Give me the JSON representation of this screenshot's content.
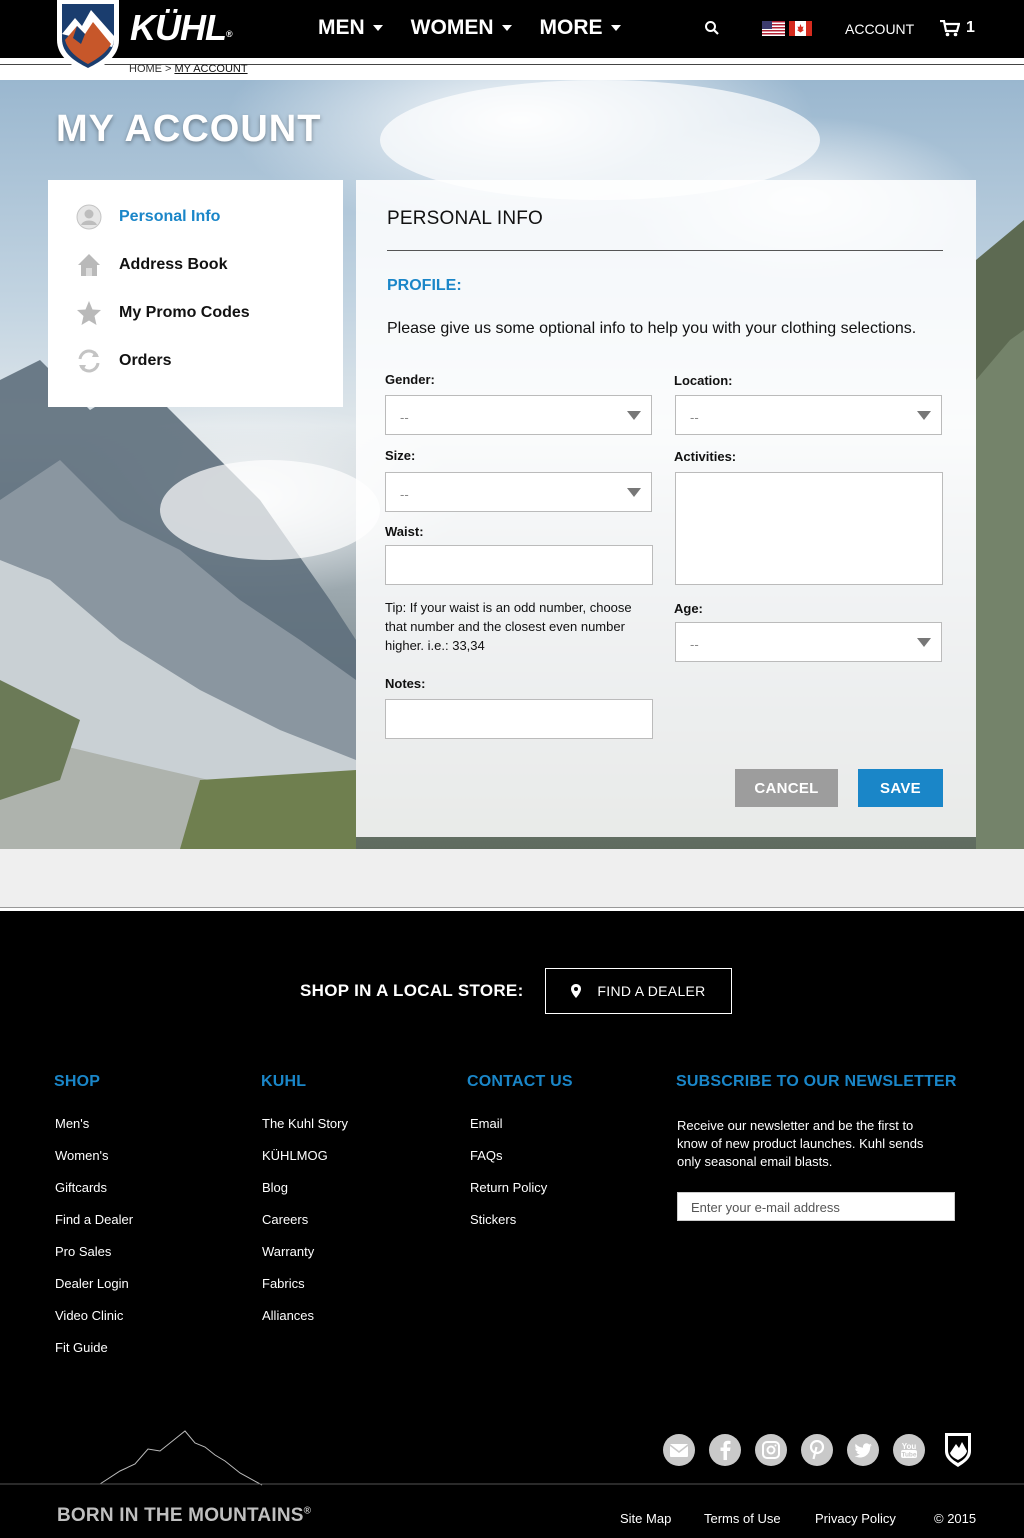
{
  "header": {
    "brand": "KÜHL",
    "brand_mark": "®",
    "nav": [
      {
        "label": "MEN"
      },
      {
        "label": "WOMEN"
      },
      {
        "label": "MORE"
      }
    ],
    "account_label": "ACCOUNT",
    "cart_count": "1"
  },
  "breadcrumb": {
    "home": "HOME",
    "separator": ">",
    "current": "MY ACCOUNT"
  },
  "page": {
    "title": "MY ACCOUNT"
  },
  "sidebar": {
    "items": [
      {
        "label": "Personal Info",
        "icon": "user-icon",
        "active": true
      },
      {
        "label": "Address Book",
        "icon": "home-icon"
      },
      {
        "label": "My Promo Codes",
        "icon": "star-icon"
      },
      {
        "label": "Orders",
        "icon": "refresh-icon"
      }
    ]
  },
  "form": {
    "title": "PERSONAL INFO",
    "section": "PROFILE:",
    "intro": "Please give us some optional info to help you with your clothing selections.",
    "gender": {
      "label": "Gender:",
      "value": "--"
    },
    "location": {
      "label": "Location:",
      "value": "--"
    },
    "size": {
      "label": "Size:",
      "value": "--"
    },
    "activities": {
      "label": "Activities:"
    },
    "waist": {
      "label": "Waist:",
      "value": ""
    },
    "tip": "Tip: If your waist is an odd number, choose that number and the closest even number higher. i.e.: 33,34",
    "age": {
      "label": "Age:",
      "value": "--"
    },
    "notes": {
      "label": "Notes:",
      "value": ""
    },
    "cancel_label": "CANCEL",
    "save_label": "SAVE"
  },
  "footer": {
    "local_store_label": "SHOP IN A LOCAL STORE:",
    "find_dealer_label": "FIND A DEALER",
    "columns": [
      {
        "title": "SHOP",
        "links": [
          "Men's",
          "Women's",
          "Giftcards",
          "Find a Dealer",
          "Pro Sales",
          "Dealer Login",
          "Video Clinic",
          "Fit Guide"
        ]
      },
      {
        "title": "KUHL",
        "links": [
          "The Kuhl Story",
          "KÜHLMOG",
          "Blog",
          "Careers",
          "Warranty",
          "Fabrics",
          "Alliances"
        ]
      },
      {
        "title": "CONTACT US",
        "links": [
          "Email",
          "FAQs",
          "Return Policy",
          "Stickers"
        ]
      }
    ],
    "newsletter": {
      "title": "SUBSCRIBE TO OUR NEWSLETTER",
      "text": "Receive our newsletter and be the first to know of new product launches. Kuhl sends only seasonal email blasts.",
      "placeholder": "Enter your e-mail address"
    },
    "social": [
      "email-icon",
      "facebook-icon",
      "instagram-icon",
      "pinterest-icon",
      "twitter-icon",
      "youtube-icon"
    ],
    "tagline": "BORN IN THE MOUNTAINS",
    "tagline_mark": "®",
    "bottom_links": [
      "Site Map",
      "Terms of Use",
      "Privacy Policy"
    ],
    "copyright": "© 2015"
  },
  "colors": {
    "accent": "#1a86c8",
    "cancel_button": "#9d9d9d",
    "header_bg": "#000000"
  }
}
